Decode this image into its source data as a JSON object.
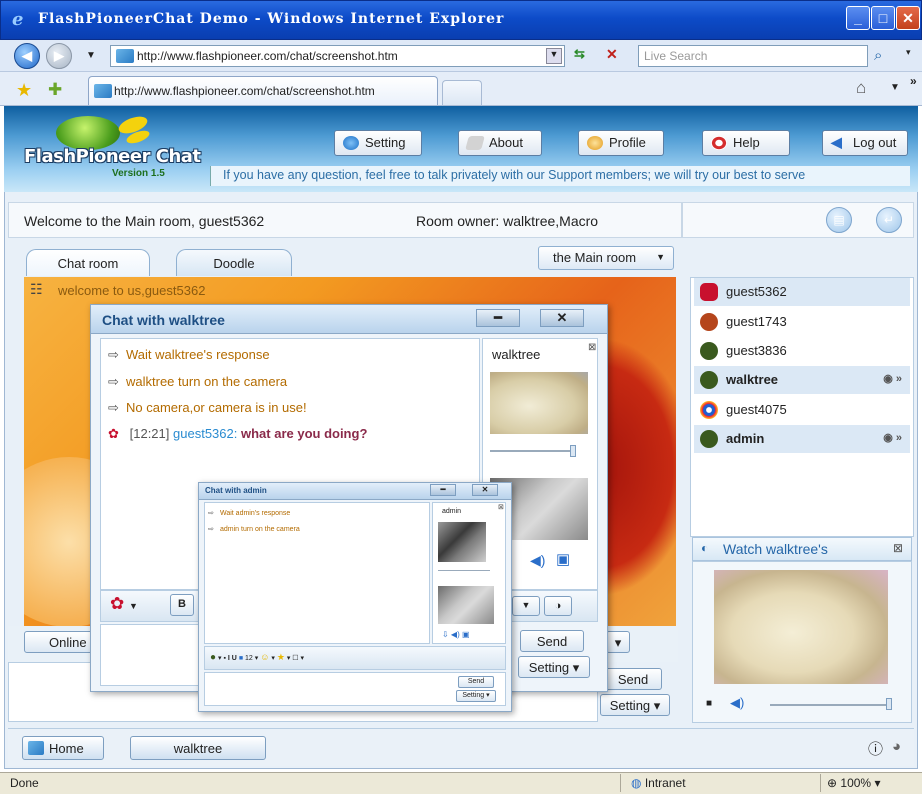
{
  "window": {
    "title": "FlashPioneerChat Demo - Windows Internet Explorer"
  },
  "browser": {
    "url": "http://www.flashpioneer.com/chat/screenshot.htm",
    "search_placeholder": "Live Search",
    "tab_title": "http://www.flashpioneer.com/chat/screenshot.htm",
    "status_text": "Done",
    "zone": "Intranet",
    "zoom": "100%"
  },
  "app": {
    "logo": "FlashPioneer Chat",
    "version": "Version 1.5",
    "buttons": {
      "setting": "Setting",
      "about": "About",
      "profile": "Profile",
      "help": "Help",
      "logout": "Log out"
    },
    "marquee": "If you have any question, feel free to talk privately with our Support members; we will try our best to serve",
    "welcome": "Welcome to the Main room, guest5362",
    "room_owner": "Room owner: walktree,Macro",
    "tabs": {
      "chat": "Chat room",
      "doodle": "Doodle"
    },
    "room_select": "the Main room",
    "welcome_msg": "welcome to us,guest5362",
    "users": [
      {
        "name": "guest5362",
        "color": "#c8102e"
      },
      {
        "name": "guest1743",
        "color": "#b5451b"
      },
      {
        "name": "guest3836",
        "color": "#3a5a1e"
      },
      {
        "name": "walktree",
        "color": "#3a5a1e"
      },
      {
        "name": "guest4075",
        "color": "#1f5fd0"
      },
      {
        "name": "admin",
        "color": "#3a5a1e"
      }
    ],
    "watch_title": "Watch walktree's",
    "online_label": "Online",
    "send": "Send",
    "setting_dd": "Setting",
    "taskbar": {
      "home": "Home",
      "walktree": "walktree"
    }
  },
  "dialog_walktree": {
    "title": "Chat with walktree",
    "messages": [
      "Wait walktree's response",
      "walktree turn on the camera",
      "No camera,or camera is in use!"
    ],
    "chat_time": "[12:21]",
    "chat_user": "guest5362:",
    "chat_text": "what are you doing?",
    "cam_name": "walktree",
    "bold": "B"
  },
  "dialog_admin": {
    "title": "Chat with admin",
    "messages": [
      "Wait admin's response",
      "admin turn on the camera"
    ],
    "cam_name": "admin",
    "font_size": "12",
    "send": "Send",
    "setting": "Setting"
  }
}
